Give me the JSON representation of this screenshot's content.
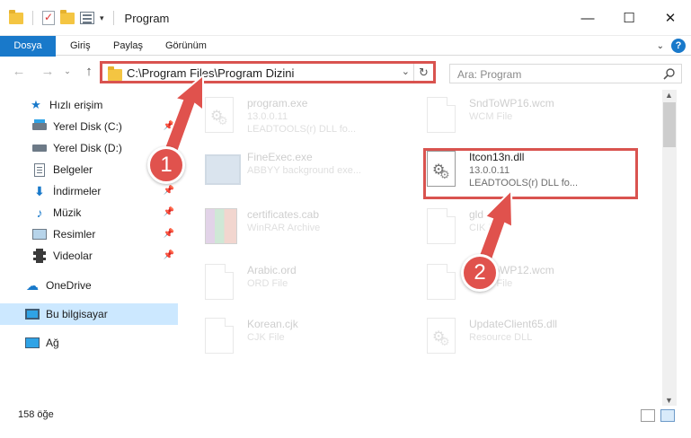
{
  "window": {
    "title": "Program"
  },
  "ribbon": {
    "tabs": [
      "Dosya",
      "Giriş",
      "Paylaş",
      "Görünüm"
    ]
  },
  "address": {
    "path": "C:\\Program Files\\Program Dizini",
    "search_placeholder": "Ara: Program"
  },
  "nav": {
    "items": [
      {
        "label": "Hızlı erişim",
        "icon": "star-icon",
        "pinned": false
      },
      {
        "label": "Yerel Disk (C:)",
        "icon": "disk-icon",
        "pinned": true
      },
      {
        "label": "Yerel Disk (D:)",
        "icon": "disk-icon",
        "pinned": false
      },
      {
        "label": "Belgeler",
        "icon": "document-icon",
        "pinned": true
      },
      {
        "label": "İndirmeler",
        "icon": "download-icon",
        "pinned": true
      },
      {
        "label": "Müzik",
        "icon": "music-icon",
        "pinned": true
      },
      {
        "label": "Resimler",
        "icon": "pictures-icon",
        "pinned": true
      },
      {
        "label": "Videolar",
        "icon": "video-icon",
        "pinned": true
      },
      {
        "label": "OneDrive",
        "icon": "cloud-icon",
        "pinned": false
      },
      {
        "label": "Bu bilgisayar",
        "icon": "computer-icon",
        "pinned": false
      },
      {
        "label": "Ağ",
        "icon": "network-icon",
        "pinned": false
      }
    ]
  },
  "files": [
    {
      "name": "program.exe",
      "meta1": "13.0.0.11",
      "meta2": "LEADTOOLS(r) DLL fo...",
      "thumb": "gear"
    },
    {
      "name": "SndToWP16.wcm",
      "meta1": "WCM File",
      "meta2": "",
      "thumb": "blank"
    },
    {
      "name": "FineExec.exe",
      "meta1": "ABBYY background exe...",
      "meta2": "",
      "thumb": "exe"
    },
    {
      "name": "Itcon13n.dll",
      "meta1": "13.0.0.11",
      "meta2": "LEADTOOLS(r) DLL fo...",
      "thumb": "gear"
    },
    {
      "name": "certificates.cab",
      "meta1": "WinRAR Archive",
      "meta2": "",
      "thumb": "rar"
    },
    {
      "name": "gld",
      "meta1": "CIK File",
      "meta2": "",
      "thumb": "blank"
    },
    {
      "name": "Arabic.ord",
      "meta1": "ORD File",
      "meta2": "",
      "thumb": "blank"
    },
    {
      "name": "SndToWP12.wcm",
      "meta1": "WCM File",
      "meta2": "",
      "thumb": "blank"
    },
    {
      "name": "Korean.cjk",
      "meta1": "CJK File",
      "meta2": "",
      "thumb": "blank"
    },
    {
      "name": "UpdateClient65.dll",
      "meta1": "Resource DLL",
      "meta2": "",
      "thumb": "gear"
    }
  ],
  "status": {
    "count": "158 öğe"
  },
  "annotations": {
    "step1": "1",
    "step2": "2",
    "accent": "#e0524d"
  }
}
